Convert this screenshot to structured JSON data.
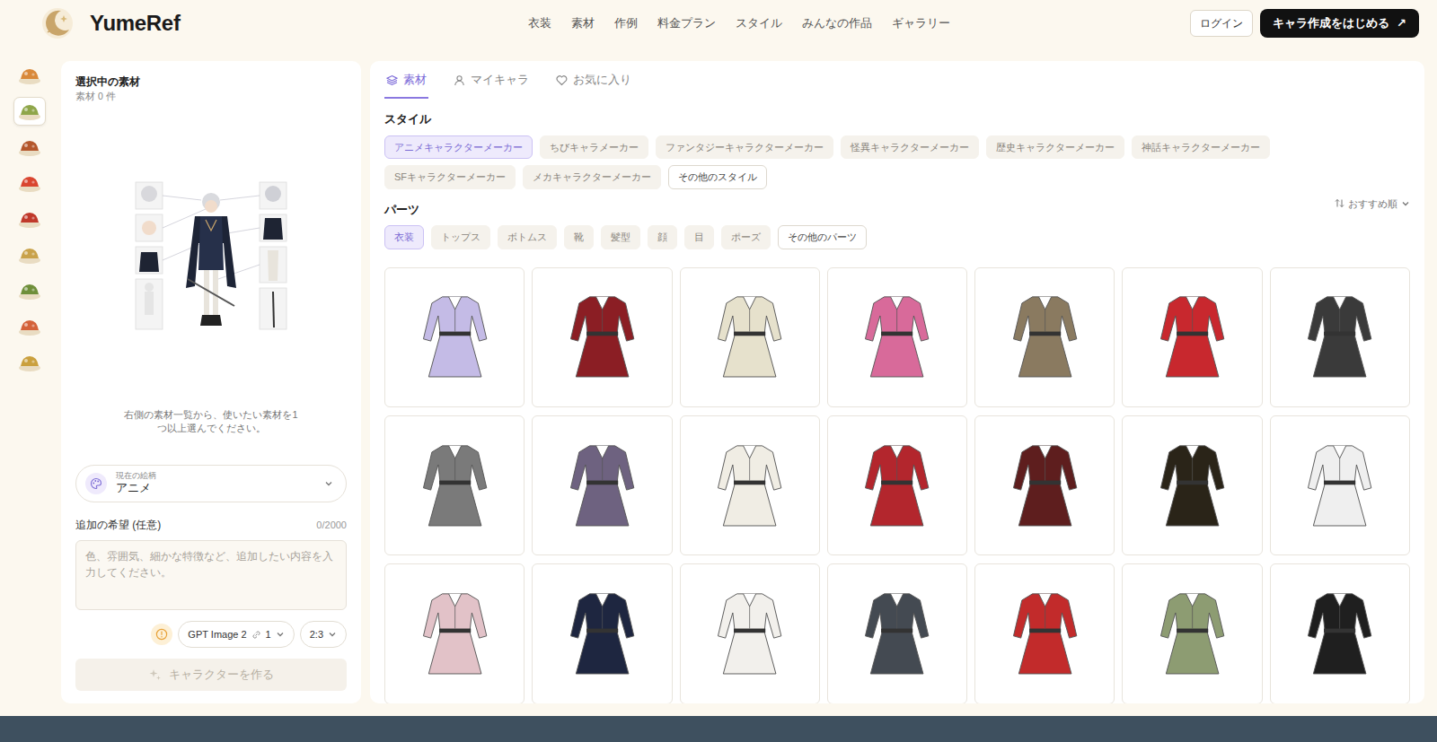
{
  "header": {
    "logo": "YumeRef",
    "nav": [
      "衣装",
      "素材",
      "作例",
      "料金プラン",
      "スタイル",
      "みんなの作品",
      "ギャラリー"
    ],
    "login": "ログイン",
    "cta": {
      "label": "キャラ作成をはじめる",
      "arrow": "↗"
    }
  },
  "rail": [
    {
      "selected": false,
      "color": "#d9893a"
    },
    {
      "selected": true,
      "color": "#8fa64a"
    },
    {
      "selected": false,
      "color": "#b4572c"
    },
    {
      "selected": false,
      "color": "#d9452f"
    },
    {
      "selected": false,
      "color": "#c0392b"
    },
    {
      "selected": false,
      "color": "#c9a24a"
    },
    {
      "selected": false,
      "color": "#6f8f3a"
    },
    {
      "selected": false,
      "color": "#d4623a"
    },
    {
      "selected": false,
      "color": "#caa03e"
    }
  ],
  "selection": {
    "title": "選択中の素材",
    "count": "素材 0 件",
    "hint": "右側の素材一覧から、使いたい素材を1つ以上選んでください。",
    "style_select": {
      "label": "現在の絵柄",
      "value": "アニメ"
    },
    "request": {
      "label": "追加の希望 (任意)",
      "counter": "0/2000",
      "placeholder": "色、雰囲気、細かな特徴など、追加したい内容を入力してください。"
    },
    "model": {
      "name": "GPT Image 2",
      "count": "1"
    },
    "ratio": "2:3",
    "create": {
      "label": "キャラクターを作る",
      "disabled": true
    }
  },
  "tabs": [
    {
      "label": "素材",
      "selected": true
    },
    {
      "label": "マイキャラ",
      "selected": false
    },
    {
      "label": "お気に入り",
      "selected": false
    }
  ],
  "styles": {
    "title": "スタイル",
    "chips": [
      {
        "label": "アニメキャラクターメーカー",
        "selected": true
      },
      {
        "label": "ちびキャラメーカー",
        "selected": false
      },
      {
        "label": "ファンタジーキャラクターメーカー",
        "selected": false
      },
      {
        "label": "怪異キャラクターメーカー",
        "selected": false
      },
      {
        "label": "歴史キャラクターメーカー",
        "selected": false
      },
      {
        "label": "神話キャラクターメーカー",
        "selected": false
      },
      {
        "label": "SFキャラクターメーカー",
        "selected": false
      },
      {
        "label": "メカキャラクターメーカー",
        "selected": false
      }
    ],
    "more": "その他のスタイル"
  },
  "parts": {
    "title": "パーツ",
    "sort": "おすすめ順",
    "chips": [
      {
        "label": "衣装",
        "selected": true
      },
      {
        "label": "トップス",
        "selected": false
      },
      {
        "label": "ボトムス",
        "selected": false
      },
      {
        "label": "靴",
        "selected": false
      },
      {
        "label": "髪型",
        "selected": false
      },
      {
        "label": "顔",
        "selected": false
      },
      {
        "label": "目",
        "selected": false
      },
      {
        "label": "ポーズ",
        "selected": false
      }
    ],
    "more": "その他のパーツ"
  },
  "costumes": [
    {
      "color": "#c4bbe6"
    },
    {
      "color": "#8b1e24"
    },
    {
      "color": "#e6e1cc"
    },
    {
      "color": "#d86a9a"
    },
    {
      "color": "#8a7a60"
    },
    {
      "color": "#c8282e"
    },
    {
      "color": "#3a3a3a"
    },
    {
      "color": "#7a7a7a"
    },
    {
      "color": "#6e6280"
    },
    {
      "color": "#f0ede4"
    },
    {
      "color": "#b3262d"
    },
    {
      "color": "#5e1e1e"
    },
    {
      "color": "#2a2418"
    },
    {
      "color": "#efefef"
    },
    {
      "color": "#e2c2c8"
    },
    {
      "color": "#1e2640"
    },
    {
      "color": "#f2f0ec"
    },
    {
      "color": "#444a52"
    },
    {
      "color": "#c22b2b"
    },
    {
      "color": "#8d9c72"
    },
    {
      "color": "#1f1f1f"
    }
  ]
}
